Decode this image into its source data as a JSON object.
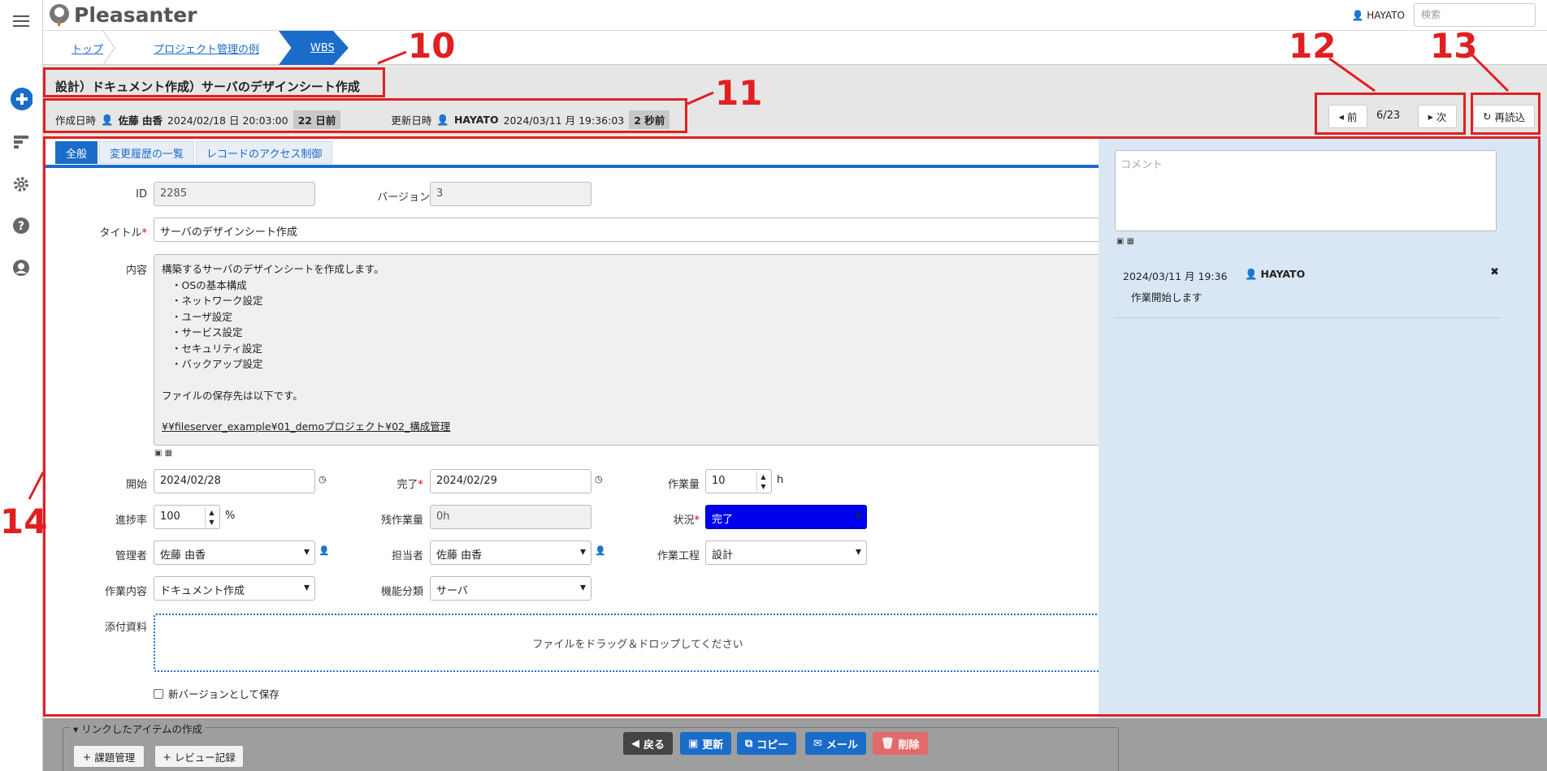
{
  "app": {
    "logo": "Pleasanter"
  },
  "header": {
    "user": "HAYATO",
    "search_placeholder": "検索"
  },
  "breadcrumb": [
    "トップ",
    "プロジェクト管理の例",
    "WBS"
  ],
  "record": {
    "title": "設計）ドキュメント作成）サーバのデザインシート作成",
    "created_label": "作成日時",
    "created_by": "佐藤 由香",
    "created_at": "2024/02/18 日 20:03:00",
    "created_ago": "22 日前",
    "updated_label": "更新日時",
    "updated_by": "HAYATO",
    "updated_at": "2024/03/11 月 19:36:03",
    "updated_ago": "2 秒前"
  },
  "nav": {
    "prev": "前",
    "position": "6/23",
    "next": "次",
    "reload": "再読込"
  },
  "tabs": [
    "全般",
    "変更履歴の一覧",
    "レコードのアクセス制御"
  ],
  "form": {
    "id_label": "ID",
    "id": "2285",
    "version_label": "バージョン",
    "version": "3",
    "title_label": "タイトル",
    "title": "サーバのデザインシート作成",
    "body_label": "内容",
    "body_lines": [
      "構築するサーバのデザインシートを作成します。",
      "・OSの基本構成",
      "・ネットワーク設定",
      "・ユーザ設定",
      "・サービス設定",
      "・セキュリティ設定",
      "・バックアップ設定",
      "",
      "ファイルの保存先は以下です。",
      "",
      "¥¥fileserver_example¥01_demoプロジェクト¥02_構成管理"
    ],
    "start_label": "開始",
    "start": "2024/02/28",
    "end_label": "完了",
    "end": "2024/02/29",
    "workload_label": "作業量",
    "workload": "10",
    "workload_unit": "h",
    "progress_label": "進捗率",
    "progress": "100",
    "progress_unit": "%",
    "remaining_label": "残作業量",
    "remaining": "0h",
    "status_label": "状況",
    "status": "完了",
    "status_color": "#0000ee",
    "manager_label": "管理者",
    "manager": "佐藤 由香",
    "owner_label": "担当者",
    "owner": "佐藤 由香",
    "process_label": "作業工程",
    "process": "設計",
    "content_label": "作業内容",
    "content": "ドキュメント作成",
    "function_label": "機能分類",
    "function": "サーバ",
    "attachment_label": "添付資料",
    "attachment_drop": "ファイルをドラッグ＆ドロップしてください",
    "new_version": "新バージョンとして保存"
  },
  "comments": {
    "placeholder": "コメント",
    "items": [
      {
        "time": "2024/03/11 月 19:36",
        "user": "HAYATO",
        "text": "作業開始します"
      }
    ]
  },
  "linked": {
    "title": "リンクしたアイテムの作成",
    "buttons": [
      "課題管理",
      "レビュー記録"
    ]
  },
  "actions": {
    "back": "戻る",
    "update": "更新",
    "copy": "コピー",
    "mail": "メール",
    "delete": "削除"
  },
  "annotations": [
    "10",
    "11",
    "12",
    "13",
    "14"
  ],
  "colors": {
    "accent": "#1a6cc9",
    "annotation": "#e02020",
    "delete": "#e26a6a"
  }
}
